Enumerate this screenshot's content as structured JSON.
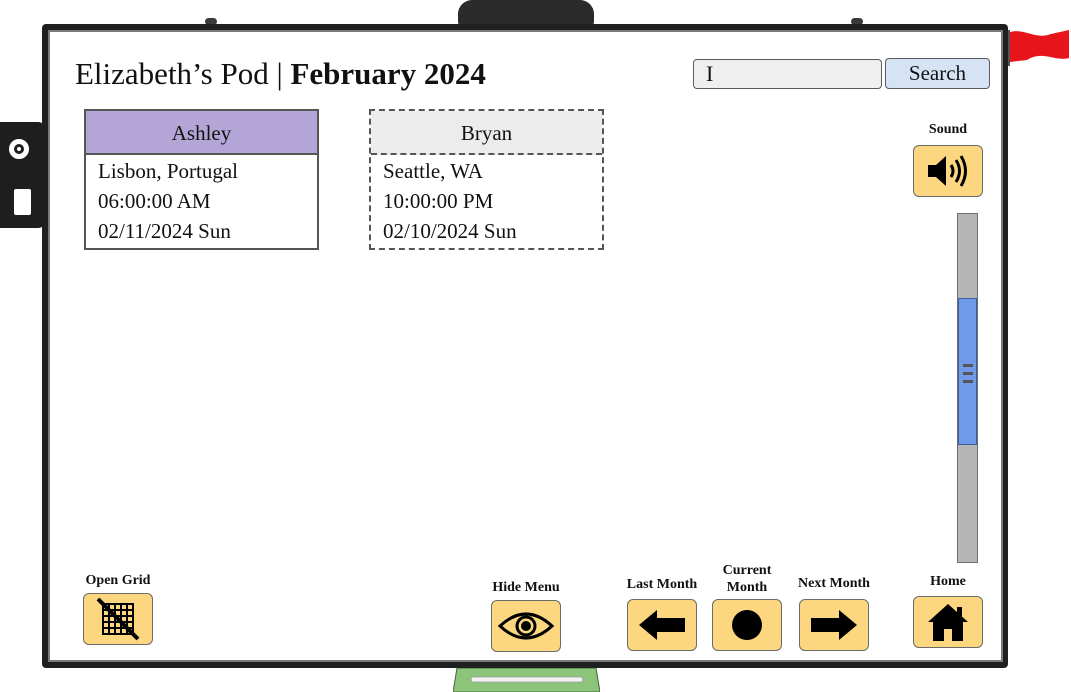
{
  "header": {
    "pod_name": "Elizabeth’s Pod | ",
    "month": "February 2024"
  },
  "search": {
    "value": "I",
    "button_label": "Search"
  },
  "pod_members": [
    {
      "name": "Ashley",
      "location": "Lisbon, Portugal",
      "time": "06:00:00 AM",
      "date": "02/11/2024 Sun",
      "header_color": "#b3a6d6"
    },
    {
      "name": "Bryan",
      "location": "Seattle, WA",
      "time": "10:00:00 PM",
      "date": "02/10/2024 Sun",
      "header_color": "#ececec"
    }
  ],
  "controls": {
    "sound_label": "Sound",
    "open_grid_label": "Open Grid",
    "hide_menu_label": "Hide Menu",
    "last_month_label": "Last Month",
    "current_month_label_1": "Current",
    "current_month_label_2": "Month",
    "next_month_label": "Next Month",
    "home_label": "Home"
  },
  "scrollbar": {
    "position_fraction": 0.24
  },
  "colors": {
    "button_fill": "#fcd77f",
    "search_button_fill": "#d5e3f4",
    "scroll_thumb": "#6e9ae8",
    "flag": "#e8141b",
    "tray": "#8cc47a"
  },
  "icons": [
    "speaker-icon",
    "grid-off-icon",
    "eye-icon",
    "arrow-left-icon",
    "circle-icon",
    "arrow-right-icon",
    "home-icon"
  ]
}
